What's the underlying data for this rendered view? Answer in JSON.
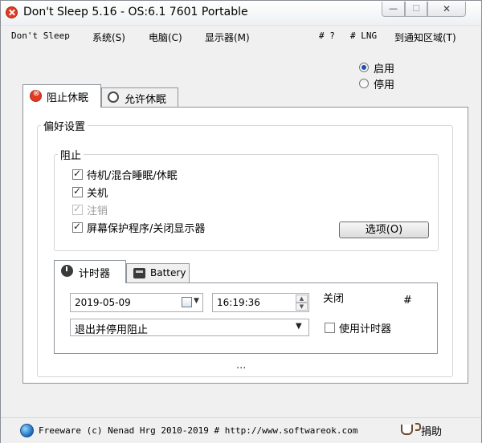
{
  "window": {
    "title": "Don't Sleep 5.16 - OS:6.1 7601 Portable",
    "controls": {
      "minimize": "—",
      "maximize": "☐",
      "close": "✕"
    }
  },
  "menu": {
    "app": "Don't Sleep",
    "system": "系统(S)",
    "computer": "电脑(C)",
    "display": "显示器(M)",
    "help": "# ?",
    "lng": "# LNG",
    "tray": "到通知区域(T)"
  },
  "mode": {
    "enable": "启用",
    "disable": "停用",
    "selected": "enable"
  },
  "tabs": {
    "prevent": "阻止休眠",
    "allow": "允许休眠",
    "active": "prevent"
  },
  "prefs": {
    "title": "偏好设置",
    "block_group": "阻止",
    "options": [
      {
        "label": "待机/混合睡眠/休眠",
        "checked": true,
        "enabled": true
      },
      {
        "label": "关机",
        "checked": true,
        "enabled": true
      },
      {
        "label": "注销",
        "checked": true,
        "enabled": false
      },
      {
        "label": "屏幕保护程序/关闭显示器",
        "checked": true,
        "enabled": true
      }
    ],
    "options_button": "选项(O)"
  },
  "timer": {
    "tabs": {
      "timer": "计时器",
      "battery": "Battery",
      "active": "timer"
    },
    "date": "2019-05-09",
    "time": "16:19:36",
    "action_label": "关闭",
    "hash": "#",
    "action_select": "退出并停用阻止",
    "use_timer_label": "使用计时器",
    "use_timer_checked": false,
    "ellipsis": "..."
  },
  "status": {
    "text": "Freeware (c) Nenad Hrg 2010-2019 # http://www.softwareok.com",
    "donate": "捐助"
  },
  "colors": {
    "accent_red": "#e55a3e",
    "window_bg": "#f0f0f0",
    "panel_bg": "#ffffff",
    "selection_blue": "#1e4fb5"
  },
  "icons": {
    "app": "stop-circle-icon",
    "allow_tab": "clock-check-icon",
    "timer_tab": "clock-icon",
    "battery_tab": "printer-battery-icon",
    "status": "globe-icon",
    "donate": "coffee-cup-icon",
    "calendar": "calendar-icon",
    "spinner": "spin-arrows-icon",
    "dropdown": "caret-down-icon"
  }
}
